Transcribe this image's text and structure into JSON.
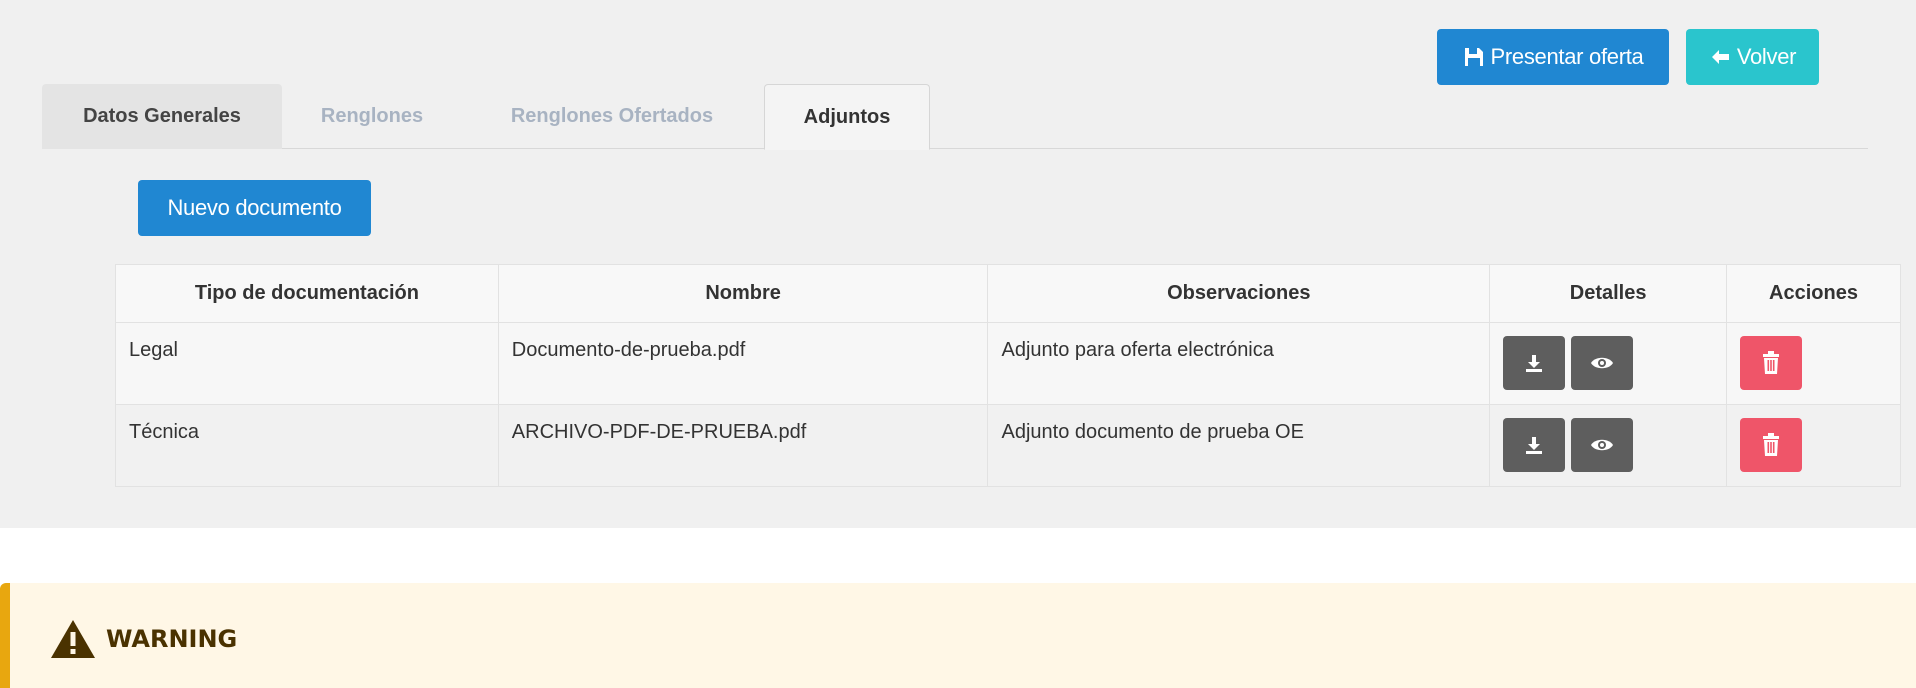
{
  "toolbar": {
    "submit_label": "Presentar oferta",
    "back_label": "Volver"
  },
  "tabs": [
    {
      "label": "Datos Generales"
    },
    {
      "label": "Renglones"
    },
    {
      "label": "Renglones Ofertados"
    },
    {
      "label": "Adjuntos"
    }
  ],
  "new_document_label": "Nuevo documento",
  "table": {
    "headers": [
      "Tipo de documentación",
      "Nombre",
      "Observaciones",
      "Detalles",
      "Acciones"
    ],
    "rows": [
      {
        "tipo": "Legal",
        "nombre": "Documento-de-prueba.pdf",
        "observaciones": "Adjunto para oferta electrónica"
      },
      {
        "tipo": "Técnica",
        "nombre": "ARCHIVO-PDF-DE-PRUEBA.pdf",
        "observaciones": "Adjunto documento de prueba OE"
      }
    ]
  },
  "warning": {
    "title": "WARNING"
  },
  "colors": {
    "primary": "#2087d2",
    "info": "#2ac5cd",
    "danger": "#ef5569",
    "dark_button": "#5e5e5e",
    "warning_accent": "#e8a70f"
  },
  "icons": {
    "submit": "save-icon",
    "back": "arrow-left-icon",
    "download": "download-icon",
    "view": "eye-icon",
    "delete": "trash-icon",
    "warning": "warning-triangle-icon"
  }
}
